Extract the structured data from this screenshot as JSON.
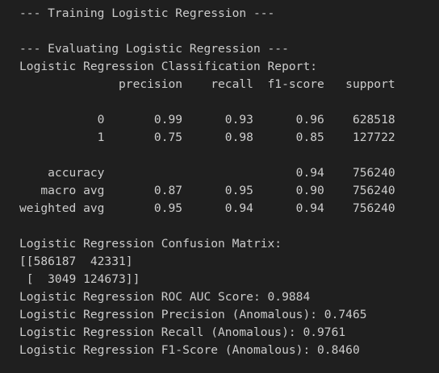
{
  "terminal": {
    "lines": [
      "--- Training Logistic Regression ---",
      "",
      "--- Evaluating Logistic Regression ---",
      "Logistic Regression Classification Report:",
      "              precision    recall  f1-score   support",
      "",
      "           0       0.99      0.93      0.96    628518",
      "           1       0.75      0.98      0.85    127722",
      "",
      "    accuracy                           0.94    756240",
      "   macro avg       0.87      0.95      0.90    756240",
      "weighted avg       0.95      0.94      0.94    756240",
      "",
      "Logistic Regression Confusion Matrix:",
      "[[586187  42331]",
      " [  3049 124673]]",
      "Logistic Regression ROC AUC Score: 0.9884",
      "Logistic Regression Precision (Anomalous): 0.7465",
      "Logistic Regression Recall (Anomalous): 0.9761",
      "Logistic Regression F1-Score (Anomalous): 0.8460"
    ]
  },
  "colors": {
    "background": "#1f1f1f",
    "text": "#cccccc"
  }
}
